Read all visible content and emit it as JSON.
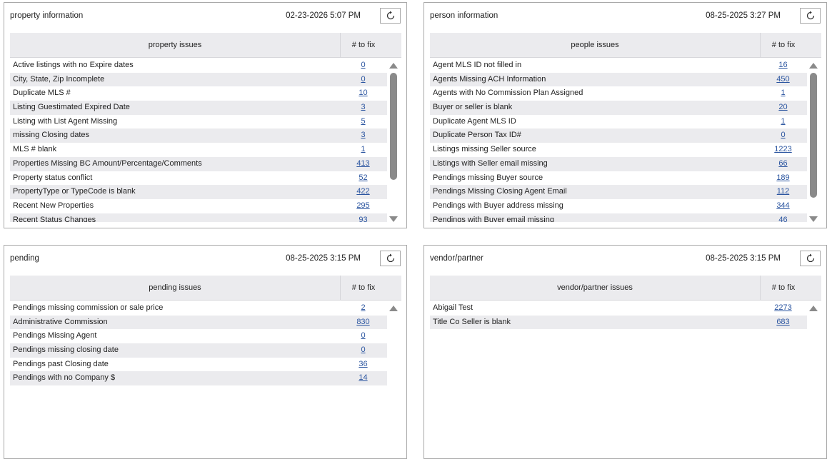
{
  "panels": [
    {
      "title": "property information",
      "timestamp": "02-23-2026 5:07 PM",
      "col_issue": "property issues",
      "col_fix": "# to fix",
      "rows": [
        {
          "label": "Active listings with no Expire dates",
          "count": "0"
        },
        {
          "label": "City, State, Zip Incomplete",
          "count": "0"
        },
        {
          "label": "Duplicate MLS #",
          "count": "10"
        },
        {
          "label": "Listing Guestimated Expired Date",
          "count": "3"
        },
        {
          "label": "Listing with List Agent Missing",
          "count": "5"
        },
        {
          "label": "missing Closing dates",
          "count": "3"
        },
        {
          "label": "MLS # blank",
          "count": "1"
        },
        {
          "label": "Properties Missing BC Amount/Percentage/Comments",
          "count": "413"
        },
        {
          "label": "Property status conflict",
          "count": "52"
        },
        {
          "label": "PropertyType or TypeCode is blank",
          "count": "422"
        },
        {
          "label": "Recent New Properties",
          "count": "295"
        },
        {
          "label": "Recent Status Changes",
          "count": "93"
        }
      ]
    },
    {
      "title": "person information",
      "timestamp": "08-25-2025 3:27 PM",
      "col_issue": "people issues",
      "col_fix": "# to fix",
      "rows": [
        {
          "label": "Agent MLS ID not filled in",
          "count": "16"
        },
        {
          "label": "Agents Missing ACH Information",
          "count": "450"
        },
        {
          "label": "Agents with No Commission Plan Assigned",
          "count": "1"
        },
        {
          "label": "Buyer or seller is blank",
          "count": "20"
        },
        {
          "label": "Duplicate Agent MLS ID",
          "count": "1"
        },
        {
          "label": "Duplicate Person Tax ID#",
          "count": "0"
        },
        {
          "label": "Listings missing Seller source",
          "count": "1223"
        },
        {
          "label": "Listings with Seller email missing",
          "count": "66"
        },
        {
          "label": "Pendings missing Buyer source",
          "count": "189"
        },
        {
          "label": "Pendings Missing Closing Agent Email",
          "count": "112"
        },
        {
          "label": "Pendings with Buyer address missing",
          "count": "344"
        },
        {
          "label": "Pendings with Buyer email missing",
          "count": "46"
        }
      ]
    },
    {
      "title": "pending",
      "timestamp": "08-25-2025 3:15 PM",
      "col_issue": "pending issues",
      "col_fix": "# to fix",
      "rows": [
        {
          "label": "Pendings missing commission or sale price",
          "count": "2"
        },
        {
          "label": "Administrative Commission",
          "count": "830"
        },
        {
          "label": "Pendings Missing Agent",
          "count": "0"
        },
        {
          "label": "Pendings missing closing date",
          "count": "0"
        },
        {
          "label": "Pendings past Closing date",
          "count": "36"
        },
        {
          "label": "Pendings with no Company $",
          "count": "14"
        }
      ]
    },
    {
      "title": "vendor/partner",
      "timestamp": "08-25-2025 3:15 PM",
      "col_issue": "vendor/partner issues",
      "col_fix": "# to fix",
      "rows": [
        {
          "label": "Abigail Test",
          "count": "2273"
        },
        {
          "label": "Title Co Seller is blank",
          "count": "683"
        }
      ]
    }
  ],
  "icons": {
    "refresh": "refresh-icon",
    "scroll_up": "scroll-up-arrow-icon",
    "scroll_down": "scroll-down-arrow-icon"
  },
  "colors": {
    "link": "#2b55a0",
    "header_bg": "#ebebee",
    "scroll_thumb": "#8a8a8a"
  }
}
